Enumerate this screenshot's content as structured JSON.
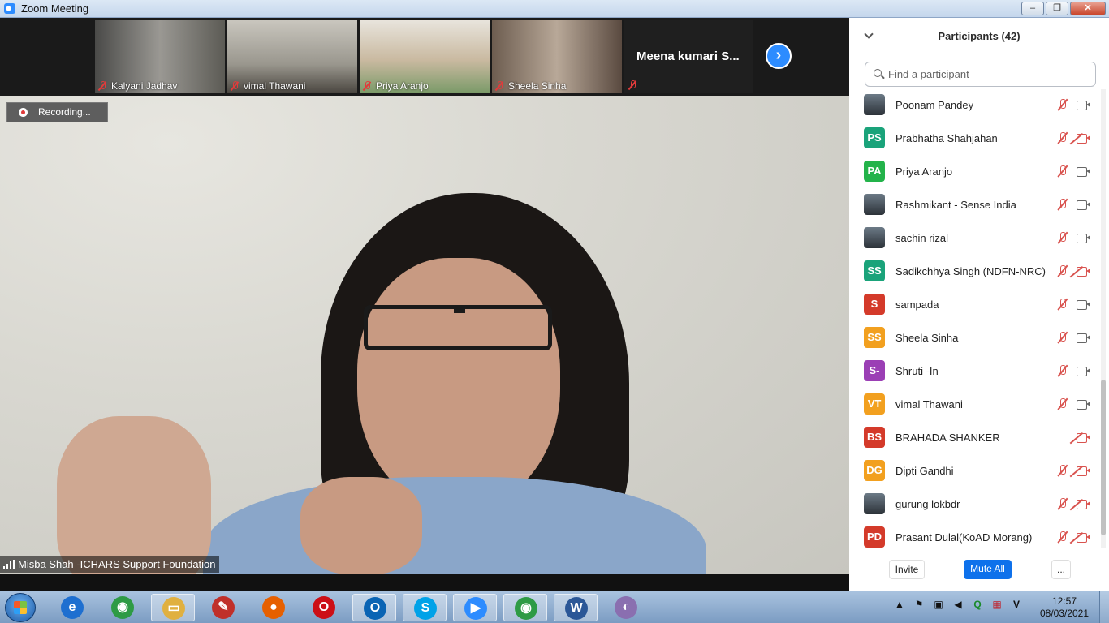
{
  "window": {
    "title": "Zoom Meeting",
    "minimize": "–",
    "maximize": "❐",
    "close": "✕"
  },
  "thumbnails": [
    {
      "name": "Kalyani Jadhav"
    },
    {
      "name": "vimal Thawani"
    },
    {
      "name": "Priya Aranjo"
    },
    {
      "name": "Sheela Sinha"
    }
  ],
  "name_only_tile": "Meena kumari S...",
  "next_arrow": "›",
  "recording_label": "Recording...",
  "active_speaker": "Misba Shah -ICHARS Support Foundation",
  "participants_panel": {
    "title": "Participants (42)",
    "search_placeholder": "Find a participant",
    "participants": [
      {
        "initials": "",
        "name": "Poonam Pandey",
        "color": "#3c4048",
        "photo": true,
        "mic": "off",
        "cam": "on"
      },
      {
        "initials": "PS",
        "name": "Prabhatha Shahjahan",
        "color": "#1aa37a",
        "photo": false,
        "mic": "off",
        "cam": "off"
      },
      {
        "initials": "PA",
        "name": "Priya Aranjo",
        "color": "#23b34a",
        "photo": false,
        "mic": "off",
        "cam": "on"
      },
      {
        "initials": "",
        "name": "Rashmikant - Sense India",
        "color": "#4f88b5",
        "photo": true,
        "mic": "off",
        "cam": "on"
      },
      {
        "initials": "",
        "name": "sachin rizal",
        "color": "#3a3a3a",
        "photo": true,
        "mic": "off",
        "cam": "on"
      },
      {
        "initials": "SS",
        "name": "Sadikchhya Singh (NDFN-NRC)",
        "color": "#1aa37a",
        "photo": false,
        "mic": "off",
        "cam": "off"
      },
      {
        "initials": "S",
        "name": "sampada",
        "color": "#d43a2a",
        "photo": false,
        "mic": "off",
        "cam": "on"
      },
      {
        "initials": "SS",
        "name": "Sheela Sinha",
        "color": "#f2a01f",
        "photo": false,
        "mic": "off",
        "cam": "on"
      },
      {
        "initials": "S-",
        "name": "Shruti -In",
        "color": "#9b3fb5",
        "photo": false,
        "mic": "off",
        "cam": "on"
      },
      {
        "initials": "VT",
        "name": "vimal Thawani",
        "color": "#f2a01f",
        "photo": false,
        "mic": "off",
        "cam": "on"
      },
      {
        "initials": "BS",
        "name": "BRAHADA SHANKER",
        "color": "#d43a2a",
        "photo": false,
        "mic": "none",
        "cam": "off"
      },
      {
        "initials": "DG",
        "name": "Dipti Gandhi",
        "color": "#f2a01f",
        "photo": false,
        "mic": "off",
        "cam": "off"
      },
      {
        "initials": "",
        "name": "gurung lokbdr",
        "color": "#5a4a3a",
        "photo": true,
        "mic": "off",
        "cam": "off"
      },
      {
        "initials": "PD",
        "name": "Prasant Dulal(KoAD Morang)",
        "color": "#d43a2a",
        "photo": false,
        "mic": "off",
        "cam": "off"
      }
    ],
    "invite_label": "Invite",
    "mute_all_label": "Mute All",
    "more_label": "..."
  },
  "taskbar": {
    "apps": [
      {
        "name": "internet-explorer",
        "glyph": "e",
        "color": "#1e6fd0",
        "active": false
      },
      {
        "name": "chrome",
        "glyph": "◉",
        "color": "#2e9b45",
        "active": false
      },
      {
        "name": "file-explorer",
        "glyph": "▭",
        "color": "#e0b040",
        "active": true
      },
      {
        "name": "paint-app",
        "glyph": "✎",
        "color": "#c0302a",
        "active": false
      },
      {
        "name": "firefox",
        "glyph": "●",
        "color": "#e66000",
        "active": false
      },
      {
        "name": "opera",
        "glyph": "O",
        "color": "#cc0f16",
        "active": false
      },
      {
        "name": "outlook",
        "glyph": "O",
        "color": "#0a64b4",
        "active": true
      },
      {
        "name": "skype",
        "glyph": "S",
        "color": "#00a2e8",
        "active": true
      },
      {
        "name": "zoom",
        "glyph": "▶",
        "color": "#2d8cff",
        "active": true
      },
      {
        "name": "chrome-2",
        "glyph": "◉",
        "color": "#2e9b45",
        "active": true
      },
      {
        "name": "word",
        "glyph": "W",
        "color": "#2b5797",
        "active": true
      },
      {
        "name": "paint",
        "glyph": "◐",
        "color": "#8a6fb0",
        "active": false
      }
    ],
    "clock_time": "12:57",
    "clock_date": "08/03/2021"
  }
}
